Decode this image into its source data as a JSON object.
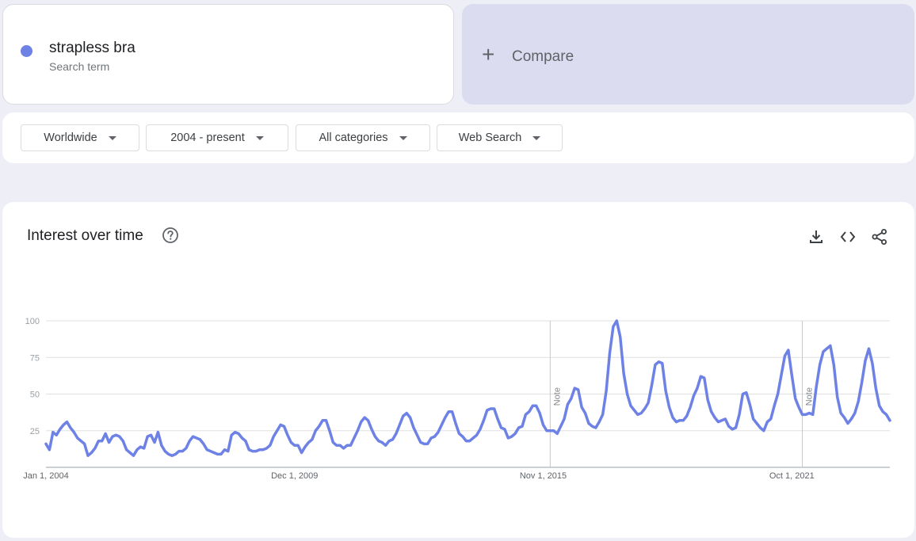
{
  "search": {
    "term": "strapless bra",
    "term_type": "Search term",
    "term_color": "#6e82e6",
    "compare_label": "Compare",
    "compare_icon": "plus-icon"
  },
  "filters": [
    {
      "label": "Worldwide"
    },
    {
      "label": "2004 - present"
    },
    {
      "label": "All categories"
    },
    {
      "label": "Web Search"
    }
  ],
  "card": {
    "title": "Interest over time",
    "help_icon": "help-circle-icon",
    "actions": [
      "download-icon",
      "embed-code-icon",
      "share-icon"
    ]
  },
  "chart_data": {
    "type": "line",
    "title": "Interest over time",
    "xlabel": "",
    "ylabel": "",
    "ylim": [
      0,
      100
    ],
    "y_ticks": [
      25,
      50,
      75,
      100
    ],
    "x_tick_labels": [
      {
        "label": "Jan 1, 2004",
        "date": "2004-01"
      },
      {
        "label": "Dec 1, 2009",
        "date": "2009-12"
      },
      {
        "label": "Nov 1, 2015",
        "date": "2015-11"
      },
      {
        "label": "Oct 1, 2021",
        "date": "2021-10"
      }
    ],
    "annotations": [
      {
        "label": "Note",
        "date": "2016-01"
      },
      {
        "label": "Note",
        "date": "2022-01"
      }
    ],
    "grid": true,
    "line_color": "#6e82e6",
    "series": [
      {
        "name": "strapless bra",
        "x_start": "2004-01",
        "frequency": "monthly",
        "points": [
          [
            "2004-01",
            16
          ],
          [
            "2004-02",
            12
          ],
          [
            "2004-03",
            24
          ],
          [
            "2004-04",
            22
          ],
          [
            "2004-05",
            26
          ],
          [
            "2004-06",
            29
          ],
          [
            "2004-07",
            31
          ],
          [
            "2004-08",
            27
          ],
          [
            "2004-09",
            24
          ],
          [
            "2004-10",
            20
          ],
          [
            "2004-11",
            18
          ],
          [
            "2004-12",
            16
          ],
          [
            "2005-01",
            8
          ],
          [
            "2005-02",
            10
          ],
          [
            "2005-03",
            13
          ],
          [
            "2005-04",
            18
          ],
          [
            "2005-05",
            18
          ],
          [
            "2005-06",
            23
          ],
          [
            "2005-07",
            17
          ],
          [
            "2005-08",
            21
          ],
          [
            "2005-09",
            22
          ],
          [
            "2005-10",
            21
          ],
          [
            "2005-11",
            18
          ],
          [
            "2005-12",
            12
          ],
          [
            "2006-01",
            10
          ],
          [
            "2006-02",
            8
          ],
          [
            "2006-03",
            12
          ],
          [
            "2006-04",
            14
          ],
          [
            "2006-05",
            13
          ],
          [
            "2006-06",
            21
          ],
          [
            "2006-07",
            22
          ],
          [
            "2006-08",
            17
          ],
          [
            "2006-09",
            24
          ],
          [
            "2006-10",
            15
          ],
          [
            "2006-11",
            11
          ],
          [
            "2006-12",
            9
          ],
          [
            "2007-01",
            8
          ],
          [
            "2007-02",
            9
          ],
          [
            "2007-03",
            11
          ],
          [
            "2007-04",
            11
          ],
          [
            "2007-05",
            13
          ],
          [
            "2007-06",
            18
          ],
          [
            "2007-07",
            21
          ],
          [
            "2007-08",
            20
          ],
          [
            "2007-09",
            19
          ],
          [
            "2007-10",
            16
          ],
          [
            "2007-11",
            12
          ],
          [
            "2007-12",
            11
          ],
          [
            "2008-01",
            10
          ],
          [
            "2008-02",
            9
          ],
          [
            "2008-03",
            9
          ],
          [
            "2008-04",
            12
          ],
          [
            "2008-05",
            11
          ],
          [
            "2008-06",
            22
          ],
          [
            "2008-07",
            24
          ],
          [
            "2008-08",
            23
          ],
          [
            "2008-09",
            20
          ],
          [
            "2008-10",
            18
          ],
          [
            "2008-11",
            12
          ],
          [
            "2008-12",
            11
          ],
          [
            "2009-01",
            11
          ],
          [
            "2009-02",
            12
          ],
          [
            "2009-03",
            12
          ],
          [
            "2009-04",
            13
          ],
          [
            "2009-05",
            15
          ],
          [
            "2009-06",
            21
          ],
          [
            "2009-07",
            25
          ],
          [
            "2009-08",
            29
          ],
          [
            "2009-09",
            28
          ],
          [
            "2009-10",
            22
          ],
          [
            "2009-11",
            17
          ],
          [
            "2009-12",
            15
          ],
          [
            "2010-01",
            15
          ],
          [
            "2010-02",
            10
          ],
          [
            "2010-03",
            14
          ],
          [
            "2010-04",
            17
          ],
          [
            "2010-05",
            19
          ],
          [
            "2010-06",
            25
          ],
          [
            "2010-07",
            28
          ],
          [
            "2010-08",
            32
          ],
          [
            "2010-09",
            32
          ],
          [
            "2010-10",
            25
          ],
          [
            "2010-11",
            17
          ],
          [
            "2010-12",
            15
          ],
          [
            "2011-01",
            15
          ],
          [
            "2011-02",
            13
          ],
          [
            "2011-03",
            15
          ],
          [
            "2011-04",
            15
          ],
          [
            "2011-05",
            20
          ],
          [
            "2011-06",
            25
          ],
          [
            "2011-07",
            31
          ],
          [
            "2011-08",
            34
          ],
          [
            "2011-09",
            32
          ],
          [
            "2011-10",
            26
          ],
          [
            "2011-11",
            21
          ],
          [
            "2011-12",
            18
          ],
          [
            "2012-01",
            17
          ],
          [
            "2012-02",
            15
          ],
          [
            "2012-03",
            18
          ],
          [
            "2012-04",
            19
          ],
          [
            "2012-05",
            23
          ],
          [
            "2012-06",
            29
          ],
          [
            "2012-07",
            35
          ],
          [
            "2012-08",
            37
          ],
          [
            "2012-09",
            34
          ],
          [
            "2012-10",
            27
          ],
          [
            "2012-11",
            22
          ],
          [
            "2012-12",
            17
          ],
          [
            "2013-01",
            16
          ],
          [
            "2013-02",
            16
          ],
          [
            "2013-03",
            20
          ],
          [
            "2013-04",
            21
          ],
          [
            "2013-05",
            24
          ],
          [
            "2013-06",
            29
          ],
          [
            "2013-07",
            34
          ],
          [
            "2013-08",
            38
          ],
          [
            "2013-09",
            38
          ],
          [
            "2013-10",
            30
          ],
          [
            "2013-11",
            23
          ],
          [
            "2013-12",
            21
          ],
          [
            "2014-01",
            18
          ],
          [
            "2014-02",
            18
          ],
          [
            "2014-03",
            20
          ],
          [
            "2014-04",
            22
          ],
          [
            "2014-05",
            26
          ],
          [
            "2014-06",
            32
          ],
          [
            "2014-07",
            39
          ],
          [
            "2014-08",
            40
          ],
          [
            "2014-09",
            40
          ],
          [
            "2014-10",
            33
          ],
          [
            "2014-11",
            27
          ],
          [
            "2014-12",
            26
          ],
          [
            "2015-01",
            20
          ],
          [
            "2015-02",
            21
          ],
          [
            "2015-03",
            23
          ],
          [
            "2015-04",
            27
          ],
          [
            "2015-05",
            28
          ],
          [
            "2015-06",
            36
          ],
          [
            "2015-07",
            38
          ],
          [
            "2015-08",
            42
          ],
          [
            "2015-09",
            42
          ],
          [
            "2015-10",
            37
          ],
          [
            "2015-11",
            29
          ],
          [
            "2015-12",
            25
          ],
          [
            "2016-01",
            25
          ],
          [
            "2016-02",
            25
          ],
          [
            "2016-03",
            23
          ],
          [
            "2016-04",
            28
          ],
          [
            "2016-05",
            33
          ],
          [
            "2016-06",
            43
          ],
          [
            "2016-07",
            47
          ],
          [
            "2016-08",
            54
          ],
          [
            "2016-09",
            53
          ],
          [
            "2016-10",
            41
          ],
          [
            "2016-11",
            37
          ],
          [
            "2016-12",
            30
          ],
          [
            "2017-01",
            28
          ],
          [
            "2017-02",
            27
          ],
          [
            "2017-03",
            31
          ],
          [
            "2017-04",
            36
          ],
          [
            "2017-05",
            52
          ],
          [
            "2017-06",
            78
          ],
          [
            "2017-07",
            96
          ],
          [
            "2017-08",
            100
          ],
          [
            "2017-09",
            89
          ],
          [
            "2017-10",
            64
          ],
          [
            "2017-11",
            50
          ],
          [
            "2017-12",
            42
          ],
          [
            "2018-01",
            39
          ],
          [
            "2018-02",
            36
          ],
          [
            "2018-03",
            37
          ],
          [
            "2018-04",
            40
          ],
          [
            "2018-05",
            44
          ],
          [
            "2018-06",
            56
          ],
          [
            "2018-07",
            70
          ],
          [
            "2018-08",
            72
          ],
          [
            "2018-09",
            71
          ],
          [
            "2018-10",
            52
          ],
          [
            "2018-11",
            41
          ],
          [
            "2018-12",
            34
          ],
          [
            "2019-01",
            31
          ],
          [
            "2019-02",
            32
          ],
          [
            "2019-03",
            32
          ],
          [
            "2019-04",
            35
          ],
          [
            "2019-05",
            41
          ],
          [
            "2019-06",
            49
          ],
          [
            "2019-07",
            54
          ],
          [
            "2019-08",
            62
          ],
          [
            "2019-09",
            61
          ],
          [
            "2019-10",
            46
          ],
          [
            "2019-11",
            38
          ],
          [
            "2019-12",
            34
          ],
          [
            "2020-01",
            31
          ],
          [
            "2020-02",
            32
          ],
          [
            "2020-03",
            33
          ],
          [
            "2020-04",
            28
          ],
          [
            "2020-05",
            26
          ],
          [
            "2020-06",
            27
          ],
          [
            "2020-07",
            36
          ],
          [
            "2020-08",
            50
          ],
          [
            "2020-09",
            51
          ],
          [
            "2020-10",
            43
          ],
          [
            "2020-11",
            33
          ],
          [
            "2020-12",
            30
          ],
          [
            "2021-01",
            27
          ],
          [
            "2021-02",
            25
          ],
          [
            "2021-03",
            31
          ],
          [
            "2021-04",
            33
          ],
          [
            "2021-05",
            42
          ],
          [
            "2021-06",
            50
          ],
          [
            "2021-07",
            63
          ],
          [
            "2021-08",
            76
          ],
          [
            "2021-09",
            80
          ],
          [
            "2021-10",
            63
          ],
          [
            "2021-11",
            47
          ],
          [
            "2021-12",
            41
          ],
          [
            "2022-01",
            36
          ],
          [
            "2022-02",
            36
          ],
          [
            "2022-03",
            37
          ],
          [
            "2022-04",
            36
          ],
          [
            "2022-05",
            55
          ],
          [
            "2022-06",
            70
          ],
          [
            "2022-07",
            79
          ],
          [
            "2022-08",
            81
          ],
          [
            "2022-09",
            83
          ],
          [
            "2022-10",
            70
          ],
          [
            "2022-11",
            48
          ],
          [
            "2022-12",
            37
          ],
          [
            "2023-01",
            34
          ],
          [
            "2023-02",
            30
          ],
          [
            "2023-03",
            33
          ],
          [
            "2023-04",
            37
          ],
          [
            "2023-05",
            45
          ],
          [
            "2023-06",
            58
          ],
          [
            "2023-07",
            73
          ],
          [
            "2023-08",
            81
          ],
          [
            "2023-09",
            71
          ],
          [
            "2023-10",
            54
          ],
          [
            "2023-11",
            42
          ],
          [
            "2023-12",
            38
          ],
          [
            "2024-01",
            36
          ],
          [
            "2024-02",
            32
          ]
        ]
      }
    ]
  }
}
